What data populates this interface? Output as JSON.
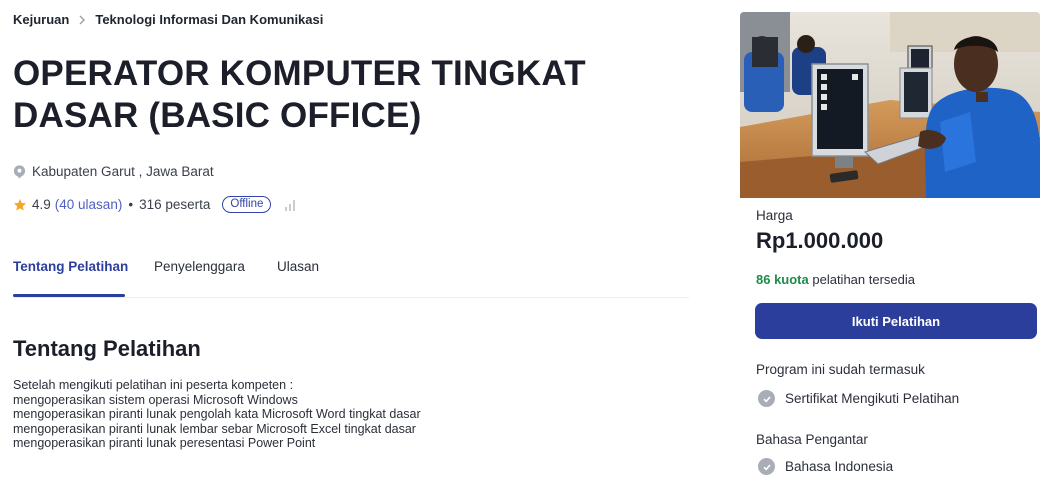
{
  "breadcrumb": {
    "root": "Kejuruan",
    "current": "Teknologi Informasi Dan Komunikasi"
  },
  "course": {
    "title": "OPERATOR KOMPUTER TINGKAT DASAR (BASIC OFFICE)",
    "location": "Kabupaten Garut , Jawa Barat",
    "rating": "4.9",
    "reviews": "(40 ulasan)",
    "separator": "•",
    "participants": "316 peserta",
    "mode_badge": "Offline"
  },
  "tabs": [
    "Tentang Pelatihan",
    "Penyelenggara",
    "Ulasan"
  ],
  "about": {
    "title": "Tentang Pelatihan",
    "lines": [
      "Setelah mengikuti pelatihan ini peserta kompeten :",
      "mengoperasikan sistem operasi Microsoft Windows",
      "mengoperasikan piranti lunak pengolah kata Microsoft Word tingkat dasar",
      "mengoperasikan piranti lunak lembar sebar Microsoft Excel tingkat dasar",
      "mengoperasikan piranti lunak peresentasi Power Point"
    ]
  },
  "card": {
    "price_label": "Harga",
    "price_value": "Rp1.000.000",
    "quota_number": "86 kuota",
    "quota_text": " pelatihan tersedia",
    "cta_label": "Ikuti Pelatihan",
    "included_title": "Program ini sudah termasuk",
    "included_item": "Sertifikat Mengikuti Pelatihan",
    "language_title": "Bahasa Pengantar",
    "language_item": "Bahasa Indonesia"
  },
  "icons": {
    "breadcrumb_separator": "chevron-right-icon",
    "location": "location-pin-icon",
    "rating": "star-icon",
    "level": "signal-bars-icon",
    "check": "check-circle-icon"
  },
  "colors": {
    "primary": "#2c3e9b",
    "quota_green": "#1f8a4c",
    "star": "#f5a623",
    "text": "#1f2430"
  }
}
